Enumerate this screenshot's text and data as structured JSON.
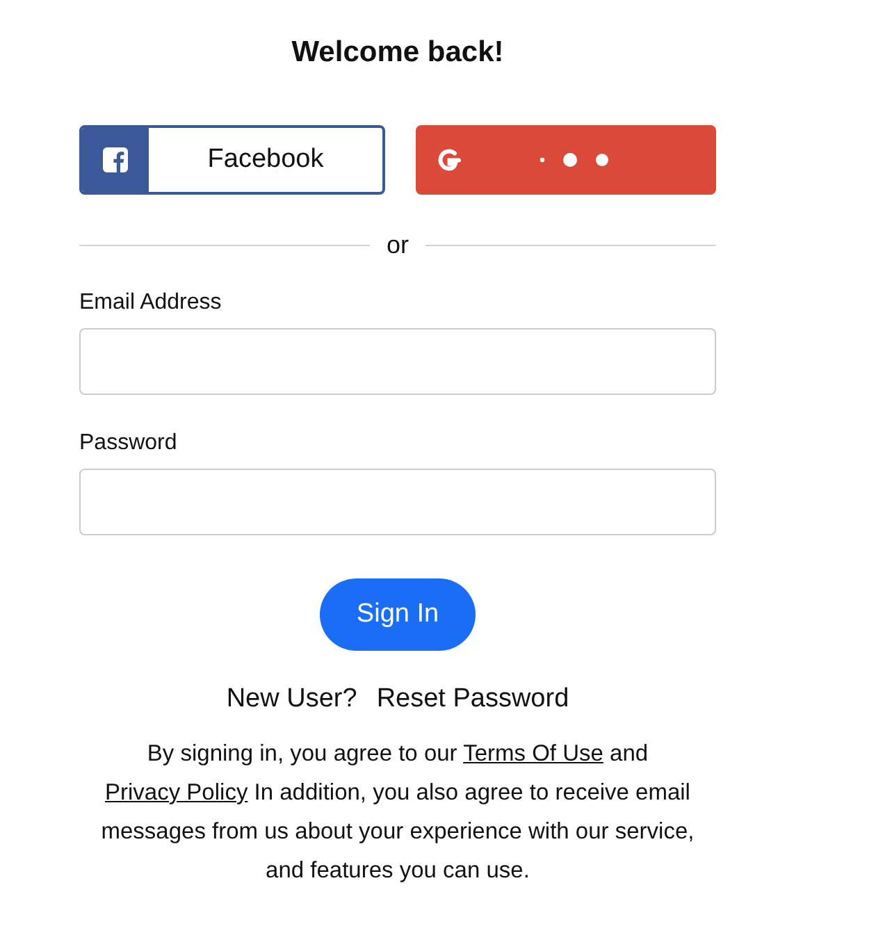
{
  "title": "Welcome back!",
  "social_buttons": [
    {
      "kind": "facebook",
      "label": "Facebook"
    },
    {
      "kind": "google",
      "loading": true
    }
  ],
  "divider": "or",
  "fields": [
    {
      "label": "Email Address"
    },
    {
      "label": "Password"
    }
  ],
  "submit": "Sign In",
  "links": [
    "New User?",
    "Reset Password"
  ],
  "legal": [
    {
      "kind": "text",
      "text": "By signing in, you agree to our "
    },
    {
      "kind": "link",
      "text": "Terms Of Use"
    },
    {
      "kind": "text",
      "text": " and "
    },
    {
      "kind": "link",
      "text": "Privacy Policy"
    },
    {
      "kind": "text",
      "text": " In addition, you also agree to receive email messages from us about your experience with our service, and features you can use."
    }
  ]
}
